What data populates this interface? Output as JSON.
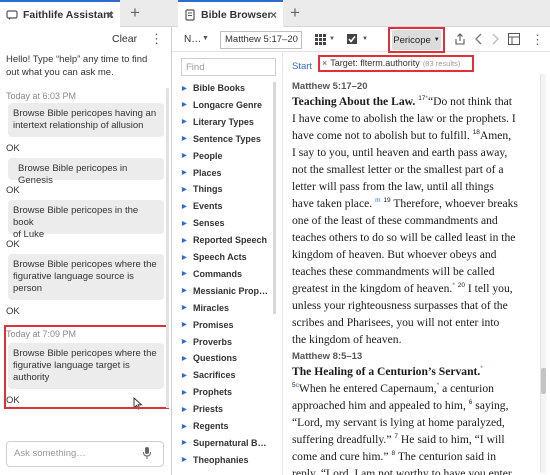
{
  "assistant": {
    "tab_title": "Faithlife Assistant",
    "close_glyph": "×",
    "new_tab_glyph": "+",
    "clear_label": "Clear",
    "menu_glyph": "⋮",
    "greeting_line1": "Hello! Type “help” any time to find",
    "greeting_line2": "out what you can ask me.",
    "time1": "Today at 6:03 PM",
    "q1_line1": "Browse Bible pericopes having an",
    "q1_line2": "intertext relationship of allusion",
    "ok1": "OK",
    "q2": "Browse Bible pericopes in Genesis",
    "ok2": "OK",
    "q3_line1": "Browse Bible pericopes in the book",
    "q3_line2": "of Luke",
    "ok3": "OK",
    "q4_line1": "Browse Bible pericopes where the",
    "q4_line2": "figurative language source is",
    "q4_line3": "person",
    "ok4": "OK",
    "time2": "Today at 7:09 PM",
    "q5_line1": "Browse Bible pericopes where the",
    "q5_line2": "figurative language target is",
    "q5_line3": "authority",
    "ok5": "OK",
    "ask_placeholder": "Ask something…"
  },
  "browser": {
    "tab_title": "Bible Browser",
    "close_glyph": "×",
    "new_tab_glyph": "+",
    "nav_label": "N…",
    "reference": "Matthew 5:17–20",
    "pericope_label": "Pericope",
    "start_label": "Start",
    "target_x": "×",
    "target_label": "Target: flterm.authority",
    "target_count": "(83 results)",
    "find_placeholder": "Find",
    "icons": [
      "grid-icon",
      "checkbox-icon",
      "share-icon",
      "back-arrow-icon",
      "forward-arrow-icon",
      "layout-icon",
      "menu-icon"
    ]
  },
  "tree": {
    "items": [
      "Bible Books",
      "Longacre Genre",
      "Literary Types",
      "Sentence Types",
      "People",
      "Places",
      "Things",
      "Events",
      "Senses",
      "Reported Speech",
      "Speech Acts",
      "Commands",
      "Messianic Prop…",
      "Miracles",
      "Promises",
      "Proverbs",
      "Questions",
      "Sacrifices",
      "Prophets",
      "Priests",
      "Regents",
      "Supernatural B…",
      "Theophanies"
    ]
  },
  "text": {
    "section1_ref": "Matthew 5:17–20",
    "section1_heading": "Teaching About the Law.",
    "v17": "17",
    "v18": "18",
    "v19": "19",
    "v20": "20",
    "s1_l1": "“Do not think that",
    "s1_l2": "I have come to abolish the law or the prophets. I",
    "s1_l3a": "have come not to abolish but to fulfill.",
    "s1_l3b": "Amen,",
    "s1_l4": "I say to you, until heaven and earth pass away,",
    "s1_l5": "not the smallest letter or the smallest part of a",
    "s1_l6": "letter will pass from the law, until all things",
    "s1_l7a": "have taken place.",
    "s1_l7b": "Therefore, whoever breaks",
    "s1_l8": "one of the least of these commandments and",
    "s1_l9": "teaches others to do so will be called least in the",
    "s1_l10": "kingdom of heaven. But whoever obeys and",
    "s1_l11": "teaches these commandments will be called",
    "s1_l12a": "greatest in the kingdom of heaven.",
    "s1_l12b": "I tell you,",
    "s1_l13": "unless your righteousness surpasses that of the",
    "s1_l14": "scribes and Pharisees, you will not enter into",
    "s1_l15": "the kingdom of heaven.",
    "section2_ref": "Matthew 8:5–13",
    "section2_heading": "The Healing of a Centurion’s Servant.",
    "v5": "5",
    "v6": "6",
    "v7": "7",
    "v8": "8",
    "s2_l1a": "When he entered Capernaum,",
    "s2_l1b": "a centurion",
    "s2_l2a": "approached him and appealed to him,",
    "s2_l2b": "saying,",
    "s2_l3": "“Lord, my servant is lying at home paralyzed,",
    "s2_l4a": "suffering dreadfully.”",
    "s2_l4b": "He said to him, “I will",
    "s2_l5a": "come and cure him.”",
    "s2_l5b": "The centurion said in",
    "s2_l6": "reply, “Lord, I am not worthy to have you enter",
    "star": "*",
    "c": "c",
    "m": "m"
  },
  "colors": {
    "accent": "#2e6ad0",
    "highlight": "#e0303a"
  }
}
